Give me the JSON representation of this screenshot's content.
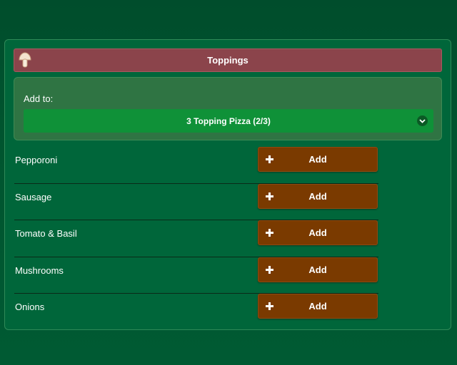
{
  "toppings_panel": {
    "title": "Toppings",
    "title_icon": "mushroom-icon",
    "add_to": {
      "label": "Add to:",
      "selected": "3 Topping Pizza (2/3)"
    },
    "items": [
      {
        "name": "Pepporoni",
        "button": "Add"
      },
      {
        "name": "Sausage",
        "button": "Add"
      },
      {
        "name": "Tomato & Basil",
        "button": "Add"
      },
      {
        "name": "Mushrooms",
        "button": "Add"
      },
      {
        "name": "Onions",
        "button": "Add"
      }
    ]
  },
  "colors": {
    "background": "#005230",
    "panel": "#00663a",
    "header": "#8b444b",
    "select": "#0f9138",
    "add_button": "#7a3a00"
  }
}
